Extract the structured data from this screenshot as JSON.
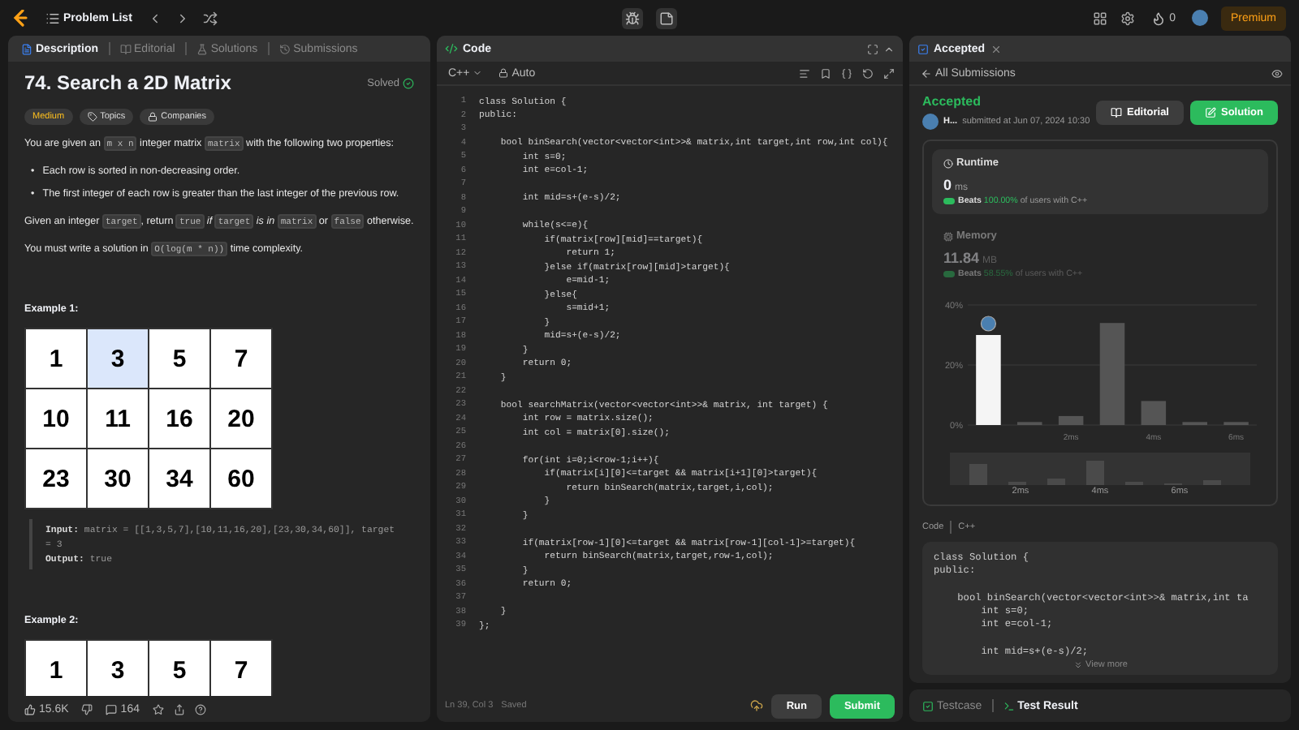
{
  "top_bar": {
    "problem_list": "Problem List",
    "streak": "0",
    "premium": "Premium"
  },
  "description_tabs": [
    {
      "label": "Description",
      "selected": true
    },
    {
      "label": "Editorial",
      "selected": false
    },
    {
      "label": "Solutions",
      "selected": false
    },
    {
      "label": "Submissions",
      "selected": false
    }
  ],
  "problem": {
    "title": "74. Search a 2D Matrix",
    "status": "Solved",
    "difficulty": "Medium",
    "tags": [
      "Topics",
      "Companies"
    ],
    "intro": [
      {
        "kind": "text",
        "text": "You are given an "
      },
      {
        "kind": "code",
        "text": "m x n"
      },
      {
        "kind": "text",
        "text": " integer matrix "
      },
      {
        "kind": "code",
        "text": "matrix"
      },
      {
        "kind": "text",
        "text": " with the following two properties:"
      }
    ],
    "bullets": [
      {
        "marker": "•",
        "text": "Each row is sorted in non-decreasing order."
      },
      {
        "marker": "•",
        "text": "The first integer of each row is greater than the last integer of the previous row."
      }
    ],
    "details": [
      [
        {
          "kind": "text",
          "text": "Given an integer "
        },
        {
          "kind": "code",
          "text": "target"
        },
        {
          "kind": "text",
          "text": ", return "
        },
        {
          "kind": "code",
          "text": "true"
        },
        {
          "kind": "italic",
          "text": " if "
        },
        {
          "kind": "code",
          "text": "target"
        },
        {
          "kind": "italic",
          "text": " is in "
        },
        {
          "kind": "code",
          "text": "matrix"
        },
        {
          "kind": "text",
          "text": " or "
        },
        {
          "kind": "code",
          "text": "false"
        },
        {
          "kind": "text",
          "text": " otherwise."
        }
      ],
      [
        {
          "kind": "text",
          "text": "You must write a solution in "
        },
        {
          "kind": "code",
          "text": "O(log(m * n))"
        },
        {
          "kind": "text",
          "text": " time complexity."
        }
      ]
    ],
    "examples": [
      {
        "heading": "Example 1:",
        "grid": [
          [
            {
              "value": "1",
              "highlighted": false
            },
            {
              "value": "3",
              "highlighted": true
            },
            {
              "value": "5",
              "highlighted": false
            },
            {
              "value": "7",
              "highlighted": false
            }
          ],
          [
            {
              "value": "10",
              "highlighted": false
            },
            {
              "value": "11",
              "highlighted": false
            },
            {
              "value": "16",
              "highlighted": false
            },
            {
              "value": "20",
              "highlighted": false
            }
          ],
          [
            {
              "value": "23",
              "highlighted": false
            },
            {
              "value": "30",
              "highlighted": false
            },
            {
              "value": "34",
              "highlighted": false
            },
            {
              "value": "60",
              "highlighted": false
            }
          ]
        ],
        "io": [
          {
            "label": "Input:",
            "value": "matrix = [[1,3,5,7],[10,11,16,20],[23,30,34,60]], target = 3"
          },
          {
            "label": "Output:",
            "value": "true"
          }
        ]
      },
      {
        "heading": "Example 2:",
        "grid": [
          [
            {
              "value": "1",
              "highlighted": false
            },
            {
              "value": "3",
              "highlighted": false
            },
            {
              "value": "5",
              "highlighted": false
            },
            {
              "value": "7",
              "highlighted": false
            }
          ]
        ]
      }
    ],
    "likes": "15.6K",
    "comments": "164"
  },
  "editor": {
    "title": "Code",
    "language": "C++",
    "mode": "Auto",
    "lines": [
      {
        "n": "1",
        "text": "class Solution {"
      },
      {
        "n": "2",
        "text": "public:"
      },
      {
        "n": "3"
      },
      {
        "n": "4",
        "text": "    bool binSearch(vector<vector<int>>& matrix,int target,int row,int col){"
      },
      {
        "n": "5",
        "text": "        int s=0;"
      },
      {
        "n": "6",
        "text": "        int e=col-1;"
      },
      {
        "n": "7"
      },
      {
        "n": "8",
        "text": "        int mid=s+(e-s)/2;"
      },
      {
        "n": "9"
      },
      {
        "n": "10",
        "text": "        while(s<=e){"
      },
      {
        "n": "11",
        "text": "            if(matrix[row][mid]==target){"
      },
      {
        "n": "12",
        "text": "                return 1;"
      },
      {
        "n": "13",
        "text": "            }else if(matrix[row][mid]>target){"
      },
      {
        "n": "14",
        "text": "                e=mid-1;"
      },
      {
        "n": "15",
        "text": "            }else{"
      },
      {
        "n": "16",
        "text": "                s=mid+1;"
      },
      {
        "n": "17",
        "text": "            }"
      },
      {
        "n": "18",
        "text": "            mid=s+(e-s)/2;"
      },
      {
        "n": "19",
        "text": "        }"
      },
      {
        "n": "20",
        "text": "        return 0;"
      },
      {
        "n": "21",
        "text": "    }"
      },
      {
        "n": "22"
      },
      {
        "n": "23",
        "text": "    bool searchMatrix(vector<vector<int>>& matrix, int target) {"
      },
      {
        "n": "24",
        "text": "        int row = matrix.size();"
      },
      {
        "n": "25",
        "text": "        int col = matrix[0].size();"
      },
      {
        "n": "26"
      },
      {
        "n": "27",
        "text": "        for(int i=0;i<row-1;i++){"
      },
      {
        "n": "28",
        "text": "            if(matrix[i][0]<=target && matrix[i+1][0]>target){"
      },
      {
        "n": "29",
        "text": "                return binSearch(matrix,target,i,col);"
      },
      {
        "n": "30",
        "text": "            }"
      },
      {
        "n": "31",
        "text": "        }"
      },
      {
        "n": "32"
      },
      {
        "n": "33",
        "text": "        if(matrix[row-1][0]<=target && matrix[row-1][col-1]>=target){"
      },
      {
        "n": "34",
        "text": "            return binSearch(matrix,target,row-1,col);"
      },
      {
        "n": "35",
        "text": "        }"
      },
      {
        "n": "36",
        "text": "        return 0;"
      },
      {
        "n": "37"
      },
      {
        "n": "38",
        "text": "    }"
      },
      {
        "n": "39",
        "text": "};"
      }
    ],
    "cursor": "Ln 39, Col 3",
    "save_status": "Saved",
    "run": "Run",
    "submit": "Submit"
  },
  "result": {
    "tab": "Accepted",
    "back": "All Submissions",
    "status": "Accepted",
    "user": "H...",
    "submitted": "submitted at Jun 07, 2024 10:30",
    "editorial": "Editorial",
    "solution": "Solution",
    "metrics": [
      {
        "kind": "runtime",
        "title": "Runtime",
        "value": "0",
        "unit": "ms",
        "beats": "Beats",
        "percent": "100.00%",
        "suffix": "of users with C++",
        "selected": true
      },
      {
        "kind": "memory",
        "title": "Memory",
        "value": "11.84",
        "unit": "MB",
        "beats": "Beats",
        "percent": "58.55%",
        "suffix": "of users with C++",
        "selected": false
      }
    ],
    "chart_data": {
      "type": "bar",
      "x": [
        0,
        1,
        2,
        3,
        4,
        5,
        6
      ],
      "values": [
        30,
        1,
        3,
        34,
        8,
        1,
        1
      ],
      "ylim": [
        0,
        40
      ],
      "yticks": [
        {
          "value": 0,
          "label": "0%"
        },
        {
          "value": 20,
          "label": "20%"
        },
        {
          "value": 40,
          "label": "40%"
        }
      ],
      "xticks": [
        {
          "value": 2,
          "label": "2ms"
        },
        {
          "value": 4,
          "label": "4ms"
        },
        {
          "value": 6,
          "label": "6ms"
        }
      ],
      "xlim": [
        -0.5,
        6.5
      ]
    },
    "overview_labels": [
      "2ms",
      "4ms",
      "6ms"
    ],
    "code_label": "Code",
    "code_language": "C++",
    "code_lines": [
      {
        "text": "class Solution {"
      },
      {
        "text": "public:"
      },
      {
        "text": "    bool binSearch(vector<vector<int>>& matrix,int ta",
        "blank_line_before": true
      },
      {
        "text": "        int s=0;"
      },
      {
        "text": "        int e=col-1;"
      },
      {
        "text": "        int mid=s+(e-s)/2;",
        "blank_line_before": true
      }
    ],
    "view_more": "View more"
  },
  "console_tabs": [
    {
      "label": "Testcase",
      "selected": false
    },
    {
      "label": "Test Result",
      "selected": true
    }
  ]
}
